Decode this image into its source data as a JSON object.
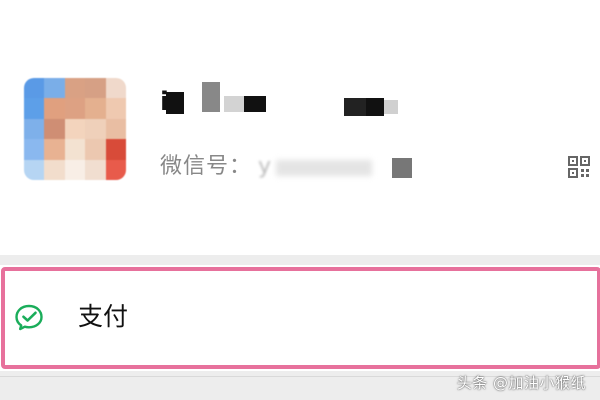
{
  "profile": {
    "name": "i",
    "wechat_id_label": "微信号：",
    "wechat_id_value": "y"
  },
  "menu": {
    "pay_label": "支付",
    "pay_icon": "wechat-pay-icon",
    "highlight_color": "#e7719c"
  },
  "watermark": "头条 @加油小猴纸"
}
